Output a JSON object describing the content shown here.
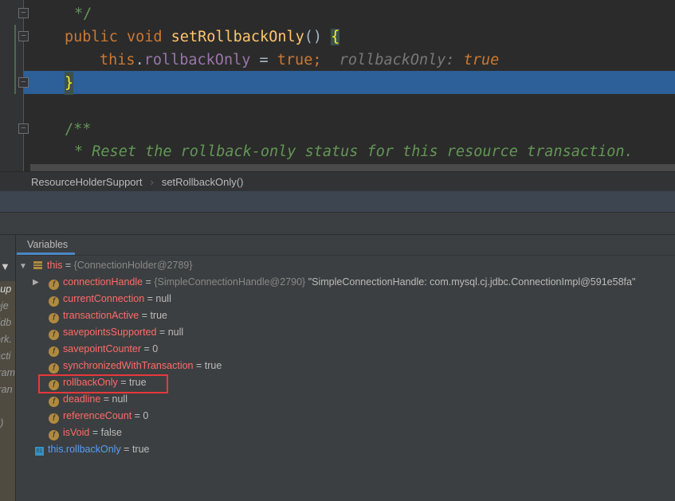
{
  "editor": {
    "lines": {
      "l0": "*/",
      "l1_kw1": "public",
      "l1_kw2": "void",
      "l1_fn": "setRollbackOnly",
      "l1_paren": "()",
      "l1_brace": "{",
      "l2_this": "this",
      "l2_dot": ".",
      "l2_field": "rollbackOnly",
      "l2_assign": " = ",
      "l2_true": "true",
      "l2_semi": ";",
      "l2_hint_label": "rollbackOnly:",
      "l2_hint_value": "true",
      "l3_brace": "}",
      "l5": "/**",
      "l6": "* Reset the rollback-only status for this resource transaction."
    }
  },
  "breadcrumb": {
    "items": [
      "ResourceHolderSupport",
      "setRollbackOnly()"
    ],
    "separator": "›"
  },
  "frames": {
    "partial": [
      "sup",
      "bje",
      ".jdb",
      "ork.",
      "acti",
      "fram",
      "tran",
      ")",
      "k)"
    ]
  },
  "variables": {
    "tab": "Variables",
    "root": {
      "name": "this",
      "eq": " = ",
      "value": "{ConnectionHolder@2789}"
    },
    "fields": [
      {
        "name": "connectionHandle",
        "value": "{SimpleConnectionHandle@2790}",
        "extra": "\"SimpleConnectionHandle: com.mysql.cj.jdbc.ConnectionImpl@591e58fa\""
      },
      {
        "name": "currentConnection",
        "value": "null"
      },
      {
        "name": "transactionActive",
        "value": "true"
      },
      {
        "name": "savepointsSupported",
        "value": "null"
      },
      {
        "name": "savepointCounter",
        "value": "0"
      },
      {
        "name": "synchronizedWithTransaction",
        "value": "true"
      },
      {
        "name": "rollbackOnly",
        "value": "true"
      },
      {
        "name": "deadline",
        "value": "null"
      },
      {
        "name": "referenceCount",
        "value": "0"
      },
      {
        "name": "isVoid",
        "value": "false"
      }
    ],
    "watch": {
      "icon": "01",
      "name": "this.rollbackOnly",
      "value": "true"
    },
    "field_icon": "f"
  },
  "colors": {
    "highlight": "#2d5f99",
    "field_name": "#ff6b68",
    "keyword": "#cc7832",
    "marker": "#e8383a"
  }
}
